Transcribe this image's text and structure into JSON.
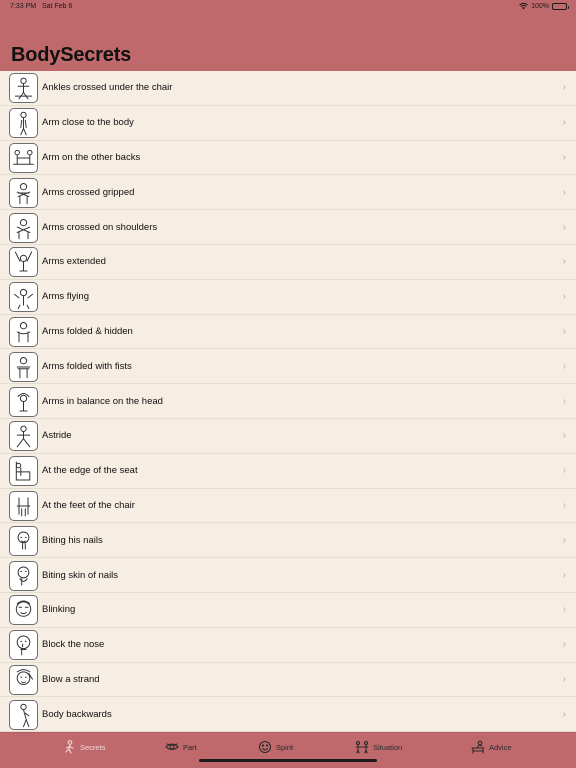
{
  "status_bar": {
    "time": "7:33 PM",
    "date": "Sat Feb 6",
    "battery": "100%"
  },
  "header": {
    "title": "BodySecrets"
  },
  "colors": {
    "accent": "#c0696c",
    "background": "#f6ede3",
    "chevron": "#b9b0a8"
  },
  "list": {
    "chevron_glyph": "›",
    "items": [
      {
        "label": "Ankles crossed under the chair"
      },
      {
        "label": "Arm close to the body"
      },
      {
        "label": "Arm on the other backs"
      },
      {
        "label": "Arms crossed gripped"
      },
      {
        "label": "Arms crossed on shoulders"
      },
      {
        "label": "Arms extended"
      },
      {
        "label": "Arms flying"
      },
      {
        "label": "Arms folded & hidden"
      },
      {
        "label": "Arms folded with fists"
      },
      {
        "label": "Arms in balance on the head"
      },
      {
        "label": "Astride"
      },
      {
        "label": "At the edge of the seat"
      },
      {
        "label": "At the feet of the chair"
      },
      {
        "label": "Biting his nails"
      },
      {
        "label": "Biting skin of nails"
      },
      {
        "label": "Blinking"
      },
      {
        "label": "Block the nose"
      },
      {
        "label": "Blow a strand"
      },
      {
        "label": "Body backwards"
      }
    ]
  },
  "tabbar": {
    "tabs": [
      {
        "label": "Secrets",
        "icon": "walking-person-icon",
        "active": true
      },
      {
        "label": "Part",
        "icon": "eye-icon",
        "active": false
      },
      {
        "label": "Spirit",
        "icon": "smiley-icon",
        "active": false
      },
      {
        "label": "Situation",
        "icon": "two-people-icon",
        "active": false
      },
      {
        "label": "Advice",
        "icon": "person-at-desk-icon",
        "active": false
      }
    ]
  }
}
